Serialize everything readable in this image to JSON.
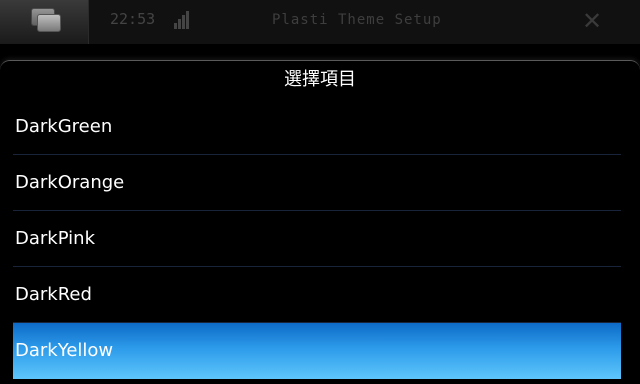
{
  "background": {
    "status_time": "22:53",
    "window_title": "Plasti Theme Setup",
    "switcher_icon": "task-switcher-icon",
    "close_icon": "close-icon"
  },
  "dialog": {
    "title": "選擇項目",
    "items": [
      {
        "label": "DarkGreen",
        "selected": false
      },
      {
        "label": "DarkOrange",
        "selected": false
      },
      {
        "label": "DarkPink",
        "selected": false
      },
      {
        "label": "DarkRed",
        "selected": false
      },
      {
        "label": "DarkYellow",
        "selected": true
      }
    ]
  },
  "colors": {
    "selection_top": "#0d6bc7",
    "selection_bottom": "#5ec6fb",
    "separator": "#17243a"
  }
}
